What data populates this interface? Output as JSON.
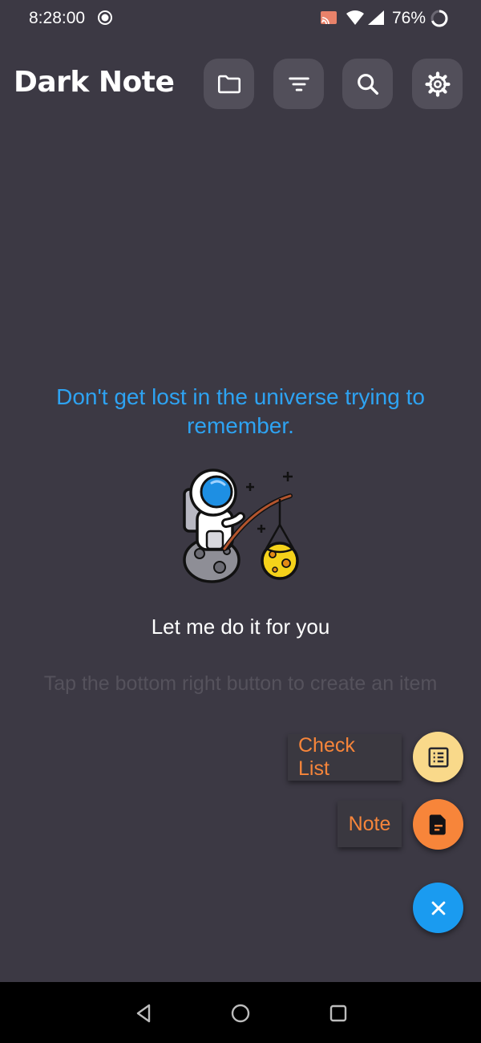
{
  "status_bar": {
    "time": "8:28:00",
    "battery": "76%",
    "icons": [
      "record-icon",
      "cast-icon",
      "wifi-icon",
      "signal-icon",
      "battery-icon"
    ]
  },
  "header": {
    "title": "Dark Note",
    "buttons": [
      "folder-icon",
      "filter-icon",
      "search-icon",
      "gear-icon"
    ]
  },
  "empty_state": {
    "tagline": "Don't get lost in the universe trying to remember.",
    "illustration": "astronaut-fishing-planet",
    "subtitle": "Let me do it for you",
    "hint": "Tap the bottom right button to create an item"
  },
  "fab_menu": {
    "checklist_label": "Check List",
    "note_label": "Note",
    "checklist_icon": "list-icon",
    "note_icon": "document-icon",
    "close_icon": "close-icon"
  },
  "colors": {
    "background": "#3c3944",
    "accent_blue": "#2ea3f2",
    "label_orange": "#f7853a",
    "checklist_fab": "#f9d98a",
    "note_fab": "#f7853a",
    "main_fab": "#1a9bf0"
  },
  "nav_bar": {
    "icons": [
      "back-icon",
      "home-icon",
      "recents-icon"
    ]
  }
}
